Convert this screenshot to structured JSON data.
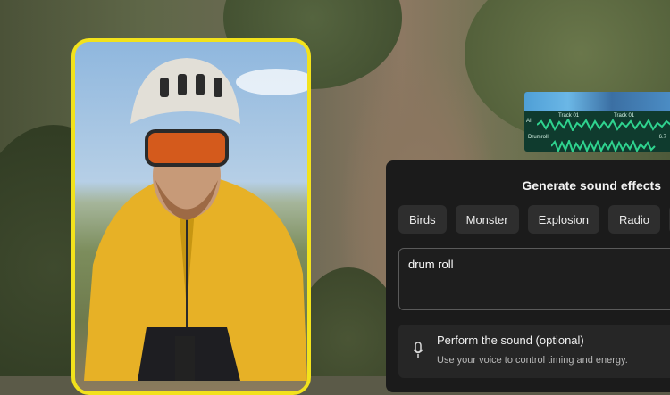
{
  "thumbnail": {
    "track_label_1": "Track 01",
    "track_label_2": "Track 01",
    "ai_badge": "AI",
    "drumroll_label": "Drumroll",
    "drumroll_value": "6.7"
  },
  "panel": {
    "title": "Generate sound effects",
    "chips": [
      "Birds",
      "Monster",
      "Explosion",
      "Radio"
    ],
    "prompt_value": "drum roll",
    "perform_title": "Perform the sound (optional)",
    "perform_subtitle": "Use your voice to control timing and energy.",
    "perform_icon": "microphone-icon"
  },
  "colors": {
    "highlight_border": "#f2e21c",
    "panel_bg": "#1b1b1b",
    "chip_bg": "#2e2e2e",
    "wave_green": "#2fd38f"
  }
}
